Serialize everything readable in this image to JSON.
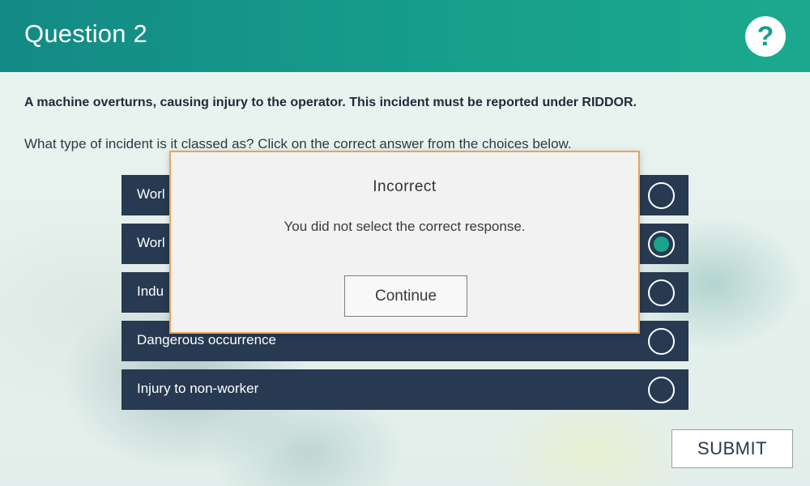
{
  "header": {
    "title": "Question 2",
    "help_label": "?"
  },
  "question": {
    "prompt": "A machine overturns, causing injury to the operator. This incident must be reported under RIDDOR.",
    "instruction": "What type of incident is it classed as? Click on the correct answer from the choices below."
  },
  "choices": [
    {
      "label": "Worl",
      "selected": false
    },
    {
      "label": "Worl",
      "selected": true
    },
    {
      "label": "Indu",
      "selected": false
    },
    {
      "label": "Dangerous occurrence",
      "selected": false
    },
    {
      "label": "Injury to non-worker",
      "selected": false
    }
  ],
  "submit_label": "SUBMIT",
  "feedback": {
    "title": "Incorrect",
    "message": "You did not select the correct response.",
    "continue_label": "Continue"
  },
  "colors": {
    "header": "#17a08c",
    "choice_bg": "#273a52",
    "selected_radio": "#18a58d",
    "modal_border": "#e8a35a"
  },
  "icons": {
    "help": "question-mark-icon",
    "radio": "radio-circle-icon"
  }
}
